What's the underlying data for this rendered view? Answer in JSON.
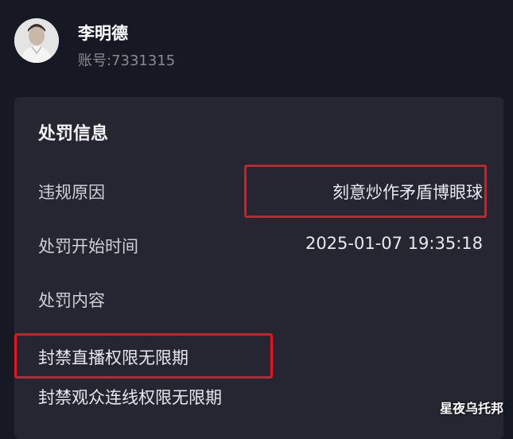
{
  "user": {
    "name": "李明德",
    "account": "账号:7331315"
  },
  "card": {
    "title": "处罚信息",
    "rows": [
      {
        "label": "违规原因",
        "value": "刻意炒作矛盾博眼球"
      },
      {
        "label": "处罚开始时间",
        "value": "2025-01-07 19:35:18"
      },
      {
        "label": "处罚内容",
        "value": ""
      }
    ],
    "content_items": [
      "封禁直播权限无限期",
      "封禁观众连线权限无限期"
    ]
  },
  "watermark": "星夜乌托邦",
  "colors": {
    "background": "#161823",
    "card": "#252632",
    "highlight": "#e3161b"
  }
}
